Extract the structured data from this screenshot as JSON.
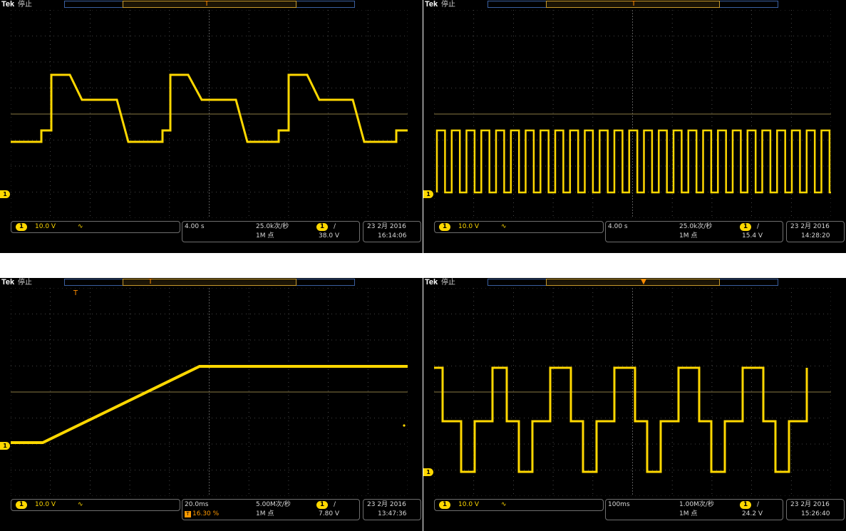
{
  "colors": {
    "trace": "#ffd800",
    "grid": "#5a5a5a",
    "trigger": "#ff8c00",
    "background": "#000000"
  },
  "screens": [
    {
      "brand": "Tek",
      "status": "停止",
      "channel_badge": "1",
      "scale": "10.0 V",
      "coupling": "∿",
      "timebase": "4.00 s",
      "sample_rate": "25.0k次/秒",
      "record_length": "1M 点",
      "trigger_badge": "1",
      "trigger_slope": "/",
      "trigger_level": "38.0 V",
      "date": "23 2月 2016",
      "time": "16:14:06",
      "trigger_position_readout": ""
    },
    {
      "brand": "Tek",
      "status": "停止",
      "channel_badge": "1",
      "scale": "10.0 V",
      "coupling": "∿",
      "timebase": "4.00 s",
      "sample_rate": "25.0k次/秒",
      "record_length": "1M 点",
      "trigger_badge": "1",
      "trigger_slope": "/",
      "trigger_level": "15.4 V",
      "date": "23 2月 2016",
      "time": "14:28:20",
      "trigger_position_readout": ""
    },
    {
      "brand": "Tek",
      "status": "停止",
      "channel_badge": "1",
      "scale": "10.0 V",
      "coupling": "∿",
      "timebase": "20.0ms",
      "sample_rate": "5.00M次/秒",
      "record_length": "1M 点",
      "trigger_badge": "1",
      "trigger_slope": "/",
      "trigger_level": "7.80 V",
      "date": "23 2月 2016",
      "time": "13:47:36",
      "trigger_position_readout": "16.30 %"
    },
    {
      "brand": "Tek",
      "status": "停止",
      "channel_badge": "1",
      "scale": "10.0 V",
      "coupling": "∿",
      "timebase": "100ms",
      "sample_rate": "1.00M次/秒",
      "record_length": "1M 点",
      "trigger_badge": "1",
      "trigger_slope": "/",
      "trigger_level": "24.2 V",
      "date": "23 2月 2016",
      "time": "15:26:40",
      "trigger_position_readout": ""
    }
  ]
}
